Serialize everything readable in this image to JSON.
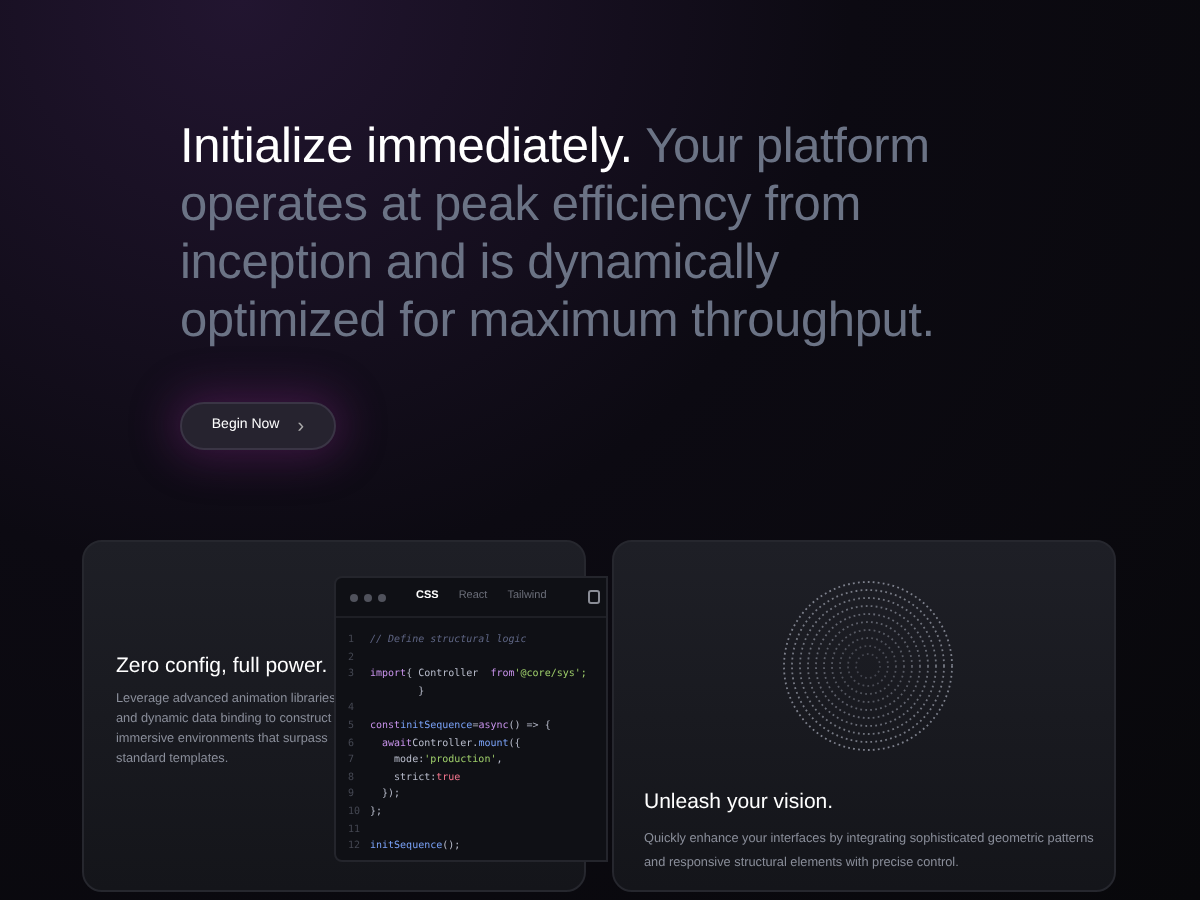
{
  "hero": {
    "lead": "Initialize immediately.",
    "text": "Your platform operates at peak efficiency from inception and is dynamically optimized for maximum throughput.",
    "button": "Begin Now",
    "button_icon": "›"
  },
  "cards": [
    {
      "kind": "code",
      "title": "Zero config, full power.",
      "body": "Leverage advanced animation libraries and dynamic data binding to construct immersive environments that surpass standard templates.",
      "tabs": [
        {
          "label": "CSS",
          "selected": true
        },
        {
          "label": "React",
          "selected": false
        },
        {
          "label": "Tailwind",
          "selected": false
        }
      ],
      "lines": [
        {
          "num": "1",
          "tokens": [
            {
              "kind": "comment",
              "text": "// Define structural logic"
            }
          ]
        },
        {
          "num": "2"
        },
        {
          "num": "3",
          "tokens": [
            {
              "kind": "keyword",
              "text": "import"
            },
            {
              "kind": "plain",
              "text": "{ Controller  "
            },
            {
              "kind": "keyword",
              "text": "from"
            },
            {
              "kind": "string",
              "text": "'@core/sys';"
            }
          ],
          "wrap": "}"
        },
        {
          "num": "4"
        },
        {
          "num": "5",
          "tokens": [
            {
              "kind": "keyword",
              "text": "const"
            },
            {
              "kind": "func",
              "text": "initSequence"
            },
            {
              "kind": "plain",
              "text": "="
            },
            {
              "kind": "keyword",
              "text": "async"
            },
            {
              "kind": "plain",
              "text": "() => {"
            }
          ]
        },
        {
          "num": "6",
          "tokens": [
            {
              "kind": "keyword",
              "text": "  await"
            },
            {
              "kind": "plain",
              "text": "Controller."
            },
            {
              "kind": "func",
              "text": "mount"
            },
            {
              "kind": "plain",
              "text": "({"
            }
          ]
        },
        {
          "num": "7",
          "tokens": [
            {
              "kind": "plain",
              "text": "    mode:"
            },
            {
              "kind": "string",
              "text": "'production'"
            },
            {
              "kind": "plain",
              "text": ","
            }
          ]
        },
        {
          "num": "8",
          "tokens": [
            {
              "kind": "plain",
              "text": "    strict:"
            },
            {
              "kind": "bool",
              "text": "true"
            }
          ]
        },
        {
          "num": "9",
          "tokens": [
            {
              "kind": "plain",
              "text": "  });"
            }
          ]
        },
        {
          "num": "10",
          "tokens": [
            {
              "kind": "plain",
              "text": "};"
            }
          ]
        },
        {
          "num": "11"
        },
        {
          "num": "12",
          "tokens": [
            {
              "kind": "func",
              "text": "initSequence"
            },
            {
              "kind": "plain",
              "text": "();"
            }
          ]
        }
      ]
    },
    {
      "kind": "pattern",
      "title": "Unleash your vision.",
      "body": "Quickly enhance your interfaces by integrating sophisticated geometric patterns and responsive structural elements with precise control."
    }
  ]
}
